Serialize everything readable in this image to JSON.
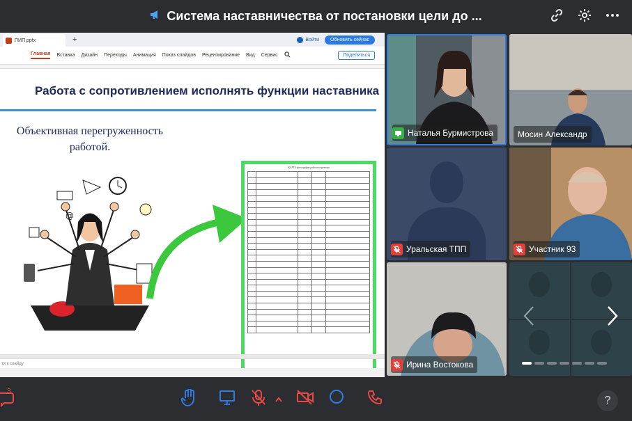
{
  "header": {
    "title": "Система наставничества от постановки цели до ..."
  },
  "presentation": {
    "tab_name": "ПИП.pptx",
    "signin_label": "Войти",
    "upgrade_label": "Обновить сейчас",
    "ribbon_tabs": [
      "Главная",
      "Вставка",
      "Дизайн",
      "Переходы",
      "Анимация",
      "Показ слайдов",
      "Рецензирование",
      "Вид",
      "Сервис"
    ],
    "share_label": "Поделиться",
    "slide_title": "Работа с сопротивлением исполнять функции наставника",
    "slide_subtitle": "Объективная перегруженность работой.",
    "notes_placeholder": "ти к слайду",
    "doc_title": "КАРТА фотографии рабочего времени"
  },
  "participants": [
    {
      "name": "Наталья Бурмистрова",
      "mic": "on"
    },
    {
      "name": "Мосин Александр",
      "mic": "none"
    },
    {
      "name": "Уральская ТПП",
      "mic": "muted"
    },
    {
      "name": "Участник 93",
      "mic": "muted"
    },
    {
      "name": "Ирина Востокова",
      "mic": "muted"
    }
  ],
  "toolbar": {
    "chat_count": "3",
    "help_label": "?"
  },
  "colors": {
    "accent": "#2e7be6",
    "danger": "#e94a47",
    "background": "#2b2d31",
    "slide_frame": "#4cd964"
  }
}
